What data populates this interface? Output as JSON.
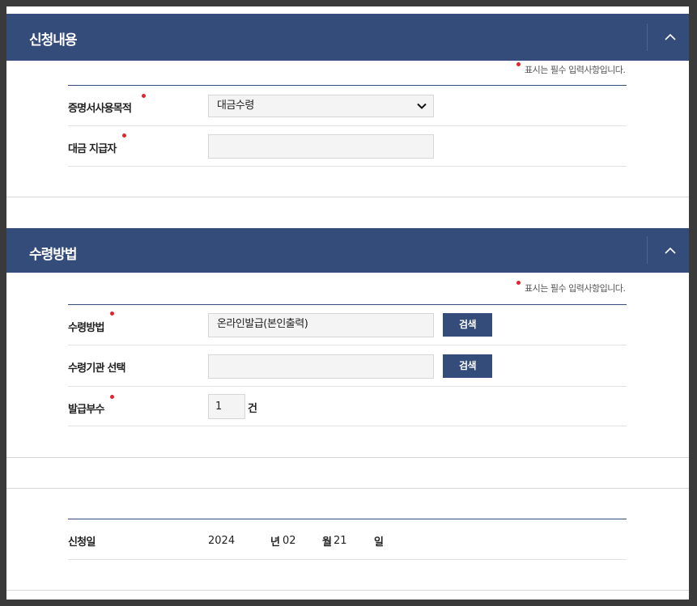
{
  "required_note": "표시는 필수 입력사항입니다.",
  "section1": {
    "title": "신청내용",
    "purpose": {
      "label": "증명서사용목적",
      "value": "대금수령"
    },
    "payer": {
      "label": "대금 지급자",
      "value": ""
    }
  },
  "section2": {
    "title": "수령방법",
    "method": {
      "label": "수령방법",
      "value": "온라인발급(본인출력)",
      "button": "검색"
    },
    "agency": {
      "label": "수령기관 선택",
      "value": "",
      "button": "검색"
    },
    "copies": {
      "label": "발급부수",
      "value": "1",
      "unit": "건"
    }
  },
  "section3": {
    "date_label": "신청일",
    "year": "2024",
    "year_unit": "년",
    "month": "02",
    "month_unit": "월",
    "day": "21",
    "day_unit": "일"
  },
  "colors": {
    "header": "#344c7a",
    "required": "#e2242f"
  },
  "icons": {
    "toggle": "chevron-up-icon",
    "select": "chevron-down-icon"
  }
}
